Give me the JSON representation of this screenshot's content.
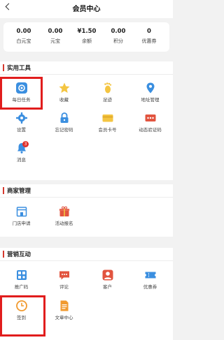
{
  "header": {
    "title": "会员中心"
  },
  "stats": [
    {
      "value": "0.00",
      "label": "白元宝"
    },
    {
      "value": "0.00",
      "label": "元宝"
    },
    {
      "value": "¥1.50",
      "label": "余额"
    },
    {
      "value": "0.00",
      "label": "积分"
    },
    {
      "value": "0",
      "label": "优惠券"
    }
  ],
  "tools": {
    "title": "实用工具",
    "items": [
      {
        "label": "每日任务",
        "icon": "daily-task-icon"
      },
      {
        "label": "收藏",
        "icon": "star-icon"
      },
      {
        "label": "足迹",
        "icon": "footprint-icon"
      },
      {
        "label": "地址管理",
        "icon": "location-pin-icon"
      },
      {
        "label": "设置",
        "icon": "gear-icon"
      },
      {
        "label": "忘记密码",
        "icon": "lock-icon"
      },
      {
        "label": "会员卡号",
        "icon": "card-icon"
      },
      {
        "label": "动态验证码",
        "icon": "verify-code-icon"
      },
      {
        "label": "消息",
        "icon": "bell-icon",
        "badge": "3"
      }
    ]
  },
  "merchant": {
    "title": "商家管理",
    "items": [
      {
        "label": "门店申请",
        "icon": "store-icon"
      },
      {
        "label": "活动报名",
        "icon": "gift-icon"
      }
    ]
  },
  "marketing": {
    "title": "营销互动",
    "items": [
      {
        "label": "推广码",
        "icon": "qr-code-icon"
      },
      {
        "label": "评论",
        "icon": "comment-icon"
      },
      {
        "label": "客户",
        "icon": "customer-icon"
      },
      {
        "label": "优惠券",
        "icon": "coupon-icon"
      },
      {
        "label": "签到",
        "icon": "clock-icon"
      },
      {
        "label": "文章中心",
        "icon": "document-icon"
      }
    ]
  },
  "colors": {
    "accent": "#d63a2f",
    "highlight": "#e11d1d",
    "blue": "#3b8fe0",
    "orange": "#f19a2f",
    "gold": "#f4c542",
    "red": "#e2543f"
  }
}
